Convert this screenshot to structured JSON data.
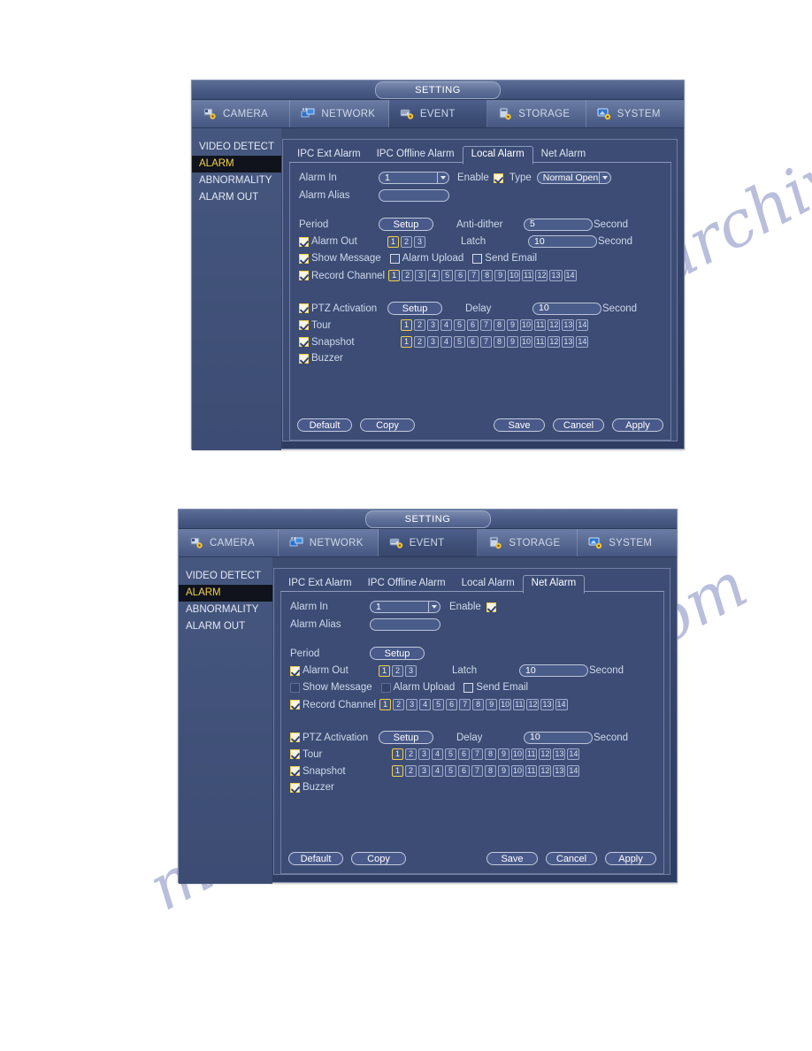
{
  "watermark": {
    "line1": "manualsarchive.com",
    "line2": "manualsarchive.com"
  },
  "panels": [
    {
      "id": "local-alarm",
      "title": "SETTING",
      "top_tabs": [
        {
          "key": "camera",
          "label": "CAMERA",
          "icon": "camera-gear-icon",
          "active": false
        },
        {
          "key": "network",
          "label": "NETWORK",
          "icon": "network-icon",
          "active": false
        },
        {
          "key": "event",
          "label": "EVENT",
          "icon": "event-gear-icon",
          "active": true
        },
        {
          "key": "storage",
          "label": "STORAGE",
          "icon": "storage-gear-icon",
          "active": false
        },
        {
          "key": "system",
          "label": "SYSTEM",
          "icon": "system-gear-icon",
          "active": false
        }
      ],
      "sidebar": [
        {
          "label": "VIDEO DETECT",
          "active": false
        },
        {
          "label": "ALARM",
          "active": true
        },
        {
          "label": "ABNORMALITY",
          "active": false
        },
        {
          "label": "ALARM OUT",
          "active": false
        }
      ],
      "sub_tabs": [
        {
          "label": "IPC Ext Alarm",
          "active": false
        },
        {
          "label": "IPC Offline Alarm",
          "active": false
        },
        {
          "label": "Local Alarm",
          "active": true
        },
        {
          "label": "Net Alarm",
          "active": false
        }
      ],
      "fields": {
        "alarm_in_label": "Alarm In",
        "alarm_in_value": "1",
        "enable_label": "Enable",
        "enable_checked": true,
        "type_label": "Type",
        "type_value": "Normal Open",
        "alarm_alias_label": "Alarm Alias",
        "alarm_alias_value": "",
        "period_label": "Period",
        "period_button": "Setup",
        "anti_dither_label": "Anti-dither",
        "anti_dither_value": "5",
        "anti_dither_unit": "Second",
        "alarm_out_label": "Alarm Out",
        "alarm_out_checked": true,
        "alarm_out_channels": [
          "1",
          "2",
          "3"
        ],
        "alarm_out_selected": [
          "1"
        ],
        "latch_label": "Latch",
        "latch_value": "10",
        "latch_unit": "Second",
        "show_message_label": "Show Message",
        "show_message_state": "checked",
        "alarm_upload_label": "Alarm Upload",
        "alarm_upload_state": "unchecked",
        "send_email_label": "Send Email",
        "send_email_state": "unchecked",
        "record_channel_label": "Record Channel",
        "record_channel_checked": true,
        "record_channels": [
          "1",
          "2",
          "3",
          "4",
          "5",
          "6",
          "7",
          "8",
          "9",
          "10",
          "11",
          "12",
          "13",
          "14"
        ],
        "record_selected": [
          "1"
        ],
        "ptz_label": "PTZ Activation",
        "ptz_checked": true,
        "ptz_button": "Setup",
        "delay_label": "Delay",
        "delay_value": "10",
        "delay_unit": "Second",
        "tour_label": "Tour",
        "tour_checked": true,
        "tour_channels": [
          "1",
          "2",
          "3",
          "4",
          "5",
          "6",
          "7",
          "8",
          "9",
          "10",
          "11",
          "12",
          "13",
          "14"
        ],
        "tour_selected": [
          "1"
        ],
        "snapshot_label": "Snapshot",
        "snapshot_checked": true,
        "snapshot_channels": [
          "1",
          "2",
          "3",
          "4",
          "5",
          "6",
          "7",
          "8",
          "9",
          "10",
          "11",
          "12",
          "13",
          "14"
        ],
        "snapshot_selected": [
          "1"
        ],
        "buzzer_label": "Buzzer",
        "buzzer_checked": true
      },
      "buttons": {
        "default": "Default",
        "copy": "Copy",
        "save": "Save",
        "cancel": "Cancel",
        "apply": "Apply"
      }
    },
    {
      "id": "net-alarm",
      "title": "SETTING",
      "top_tabs": [
        {
          "key": "camera",
          "label": "CAMERA",
          "icon": "camera-gear-icon",
          "active": false
        },
        {
          "key": "network",
          "label": "NETWORK",
          "icon": "network-icon",
          "active": false
        },
        {
          "key": "event",
          "label": "EVENT",
          "icon": "event-gear-icon",
          "active": true
        },
        {
          "key": "storage",
          "label": "STORAGE",
          "icon": "storage-gear-icon",
          "active": false
        },
        {
          "key": "system",
          "label": "SYSTEM",
          "icon": "system-gear-icon",
          "active": false
        }
      ],
      "sidebar": [
        {
          "label": "VIDEO DETECT",
          "active": false
        },
        {
          "label": "ALARM",
          "active": true
        },
        {
          "label": "ABNORMALITY",
          "active": false
        },
        {
          "label": "ALARM OUT",
          "active": false
        }
      ],
      "sub_tabs": [
        {
          "label": "IPC Ext Alarm",
          "active": false
        },
        {
          "label": "IPC Offline Alarm",
          "active": false
        },
        {
          "label": "Local Alarm",
          "active": false
        },
        {
          "label": "Net Alarm",
          "active": true
        }
      ],
      "fields": {
        "alarm_in_label": "Alarm In",
        "alarm_in_value": "1",
        "enable_label": "Enable",
        "enable_checked": true,
        "alarm_alias_label": "Alarm Alias",
        "alarm_alias_value": "",
        "period_label": "Period",
        "period_button": "Setup",
        "alarm_out_label": "Alarm Out",
        "alarm_out_checked": true,
        "alarm_out_channels": [
          "1",
          "2",
          "3"
        ],
        "alarm_out_selected": [
          "1"
        ],
        "latch_label": "Latch",
        "latch_value": "10",
        "latch_unit": "Second",
        "show_message_label": "Show Message",
        "show_message_state": "disabled",
        "alarm_upload_label": "Alarm Upload",
        "alarm_upload_state": "disabled",
        "send_email_label": "Send Email",
        "send_email_state": "unchecked",
        "record_channel_label": "Record Channel",
        "record_channel_checked": true,
        "record_channels": [
          "1",
          "2",
          "3",
          "4",
          "5",
          "6",
          "7",
          "8",
          "9",
          "10",
          "11",
          "12",
          "13",
          "14"
        ],
        "record_selected": [
          "1"
        ],
        "ptz_label": "PTZ Activation",
        "ptz_checked": true,
        "ptz_button": "Setup",
        "delay_label": "Delay",
        "delay_value": "10",
        "delay_unit": "Second",
        "tour_label": "Tour",
        "tour_checked": true,
        "tour_channels": [
          "1",
          "2",
          "3",
          "4",
          "5",
          "6",
          "7",
          "8",
          "9",
          "10",
          "11",
          "12",
          "13",
          "14"
        ],
        "tour_selected": [
          "1"
        ],
        "snapshot_label": "Snapshot",
        "snapshot_checked": true,
        "snapshot_channels": [
          "1",
          "2",
          "3",
          "4",
          "5",
          "6",
          "7",
          "8",
          "9",
          "10",
          "11",
          "12",
          "13",
          "14"
        ],
        "snapshot_selected": [
          "1"
        ],
        "buzzer_label": "Buzzer",
        "buzzer_checked": true
      },
      "buttons": {
        "default": "Default",
        "copy": "Copy",
        "save": "Save",
        "cancel": "Cancel",
        "apply": "Apply"
      }
    }
  ]
}
